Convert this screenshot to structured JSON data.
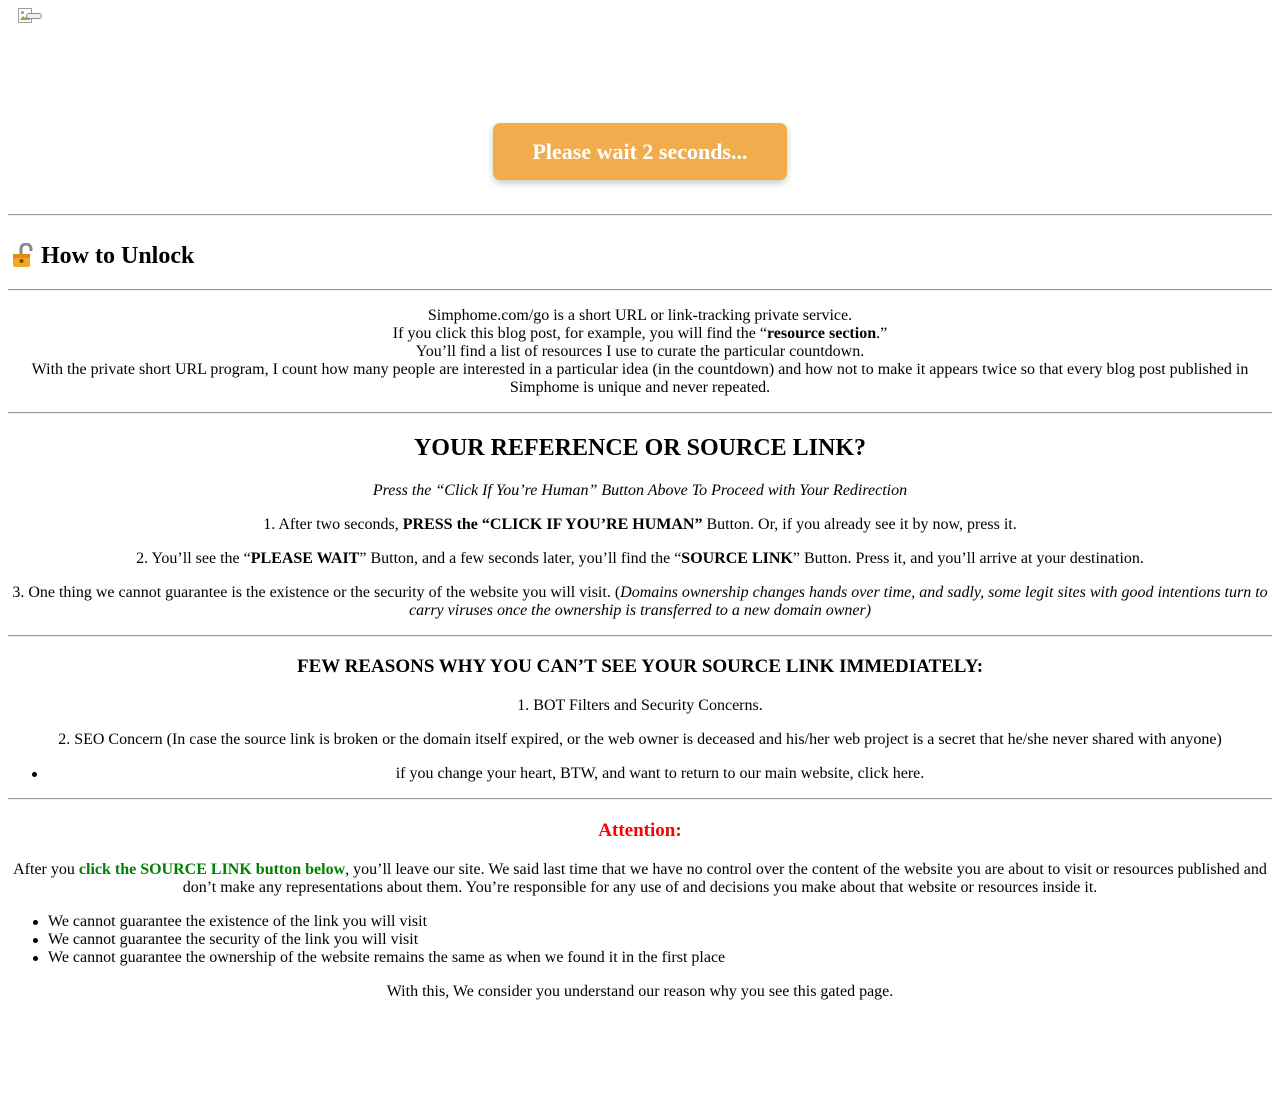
{
  "top": {
    "wait_button": "Please wait 2 seconds..."
  },
  "unlock": {
    "title": "How to Unlock",
    "lines": [
      "Simphome.com/go is a short URL or link-tracking private service.",
      "If you click this blog post, for example, you will find the “",
      "resource section",
      ".”",
      "You’ll find a list of resources I use to curate the particular countdown.",
      "With the private short URL program, I count how many people are interested in a particular idea (in the countdown) and how not to make it appears twice so that every blog post published in Simphome is unique and never repeated."
    ]
  },
  "reference": {
    "title": "YOUR REFERENCE OR SOURCE LINK?",
    "subtitle": "Press the “Click If You’re Human” Button Above To Proceed with Your Redirection",
    "step1_a": "1. After two seconds, ",
    "step1_b": "PRESS the “CLICK IF YOU’RE HUMAN”",
    "step1_c": " Button. Or, if you already see it by now, press it.",
    "step2_a": "2. You’ll see the “",
    "step2_b": "PLEASE WAIT",
    "step2_c": "” Button, and a few seconds later, you’ll find the “",
    "step2_d": "SOURCE LINK",
    "step2_e": "” Button. Press it, and you’ll arrive at your destination.",
    "step3_a": "3. One thing we cannot guarantee is the existence or the security of the website you will visit. (",
    "step3_b": "Domains ownership changes hands over time, and sadly, some legit sites with good intentions turn to carry viruses once the ownership is transferred to a new domain owner)"
  },
  "reasons": {
    "title": "FEW REASONS WHY YOU CAN’T SEE YOUR SOURCE LINK IMMEDIATELY:",
    "r1": "1. BOT Filters and Security Concerns.",
    "r2": "2. SEO Concern (In case the source link is broken or the domain itself expired, or the web owner is deceased and his/her web project is a secret that he/she never shared with anyone)",
    "bullet_a": "if you change your heart, BTW, and want to return to our main website, click ",
    "bullet_link": "here",
    "bullet_b": "."
  },
  "attention": {
    "title": "Attention:",
    "p1_a": "After you ",
    "p1_green": "click the SOURCE LINK button below",
    "p1_b": ", you’ll leave our site. We said last time that we have no control over the content of the website you are about to visit or resources published and don’t make any representations about them. You’re responsible for any use of and decisions you make about that website or resources inside it.",
    "items": [
      "We cannot guarantee the existence of the link you will visit",
      "We cannot guarantee the security of the link you will visit",
      "We cannot guarantee the ownership of the website remains the same as when we found it in the first place"
    ],
    "closing": "With this, We consider you understand our reason why you see this gated page."
  }
}
